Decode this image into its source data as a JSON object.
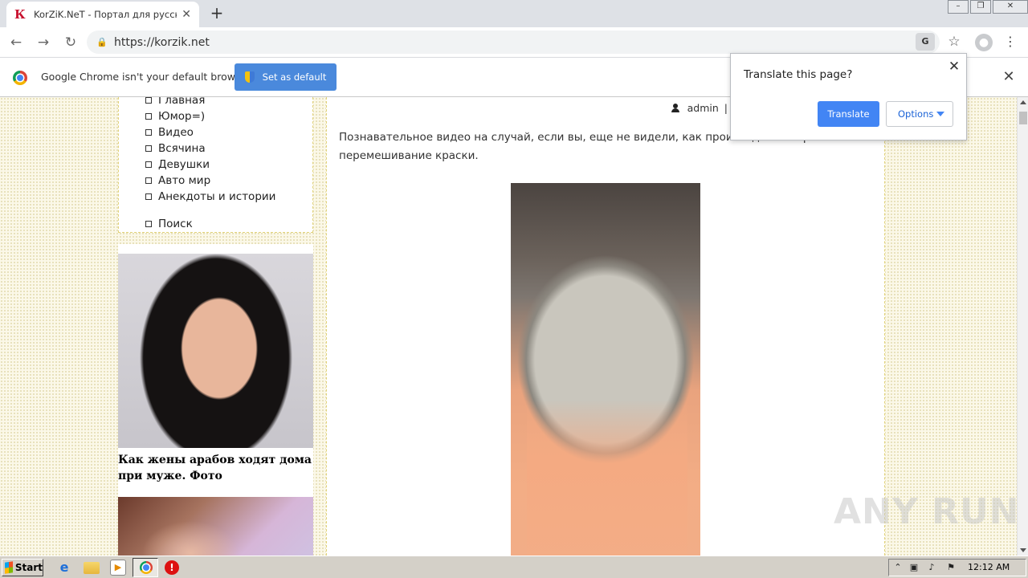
{
  "browser": {
    "tab_title": "KorZiK.NeT - Портал для русских!",
    "tab_favicon": "К",
    "url": "https://korzik.net"
  },
  "infobar": {
    "message": "Google Chrome isn't your default browser",
    "button": "Set as default"
  },
  "translate_bubble": {
    "title": "Translate this page?",
    "translate_button": "Translate",
    "options_button": "Options"
  },
  "sidebar": {
    "menu": [
      "Главная",
      "Юмор=)",
      "Видео",
      "Всячина",
      "Девушки",
      "Авто мир",
      "Анекдоты и истории"
    ],
    "search": "Поиск",
    "ad_caption_line1": "Как жены арабов ходят дома",
    "ad_caption_line2": "при муже. Фото"
  },
  "post": {
    "author": "admin",
    "separator": "|",
    "text_line1": "Познавательное видео на случай, если вы, еще не видели, как происходит колеровка и",
    "text_line2": "перемешивание краски."
  },
  "watermark": "ANY RUN",
  "taskbar": {
    "start": "Start",
    "clock": "12:12 AM"
  },
  "colors": {
    "accent_blue": "#4285f4",
    "page_bg": "#fbf8e8",
    "dashed_border": "#e2d37a"
  }
}
